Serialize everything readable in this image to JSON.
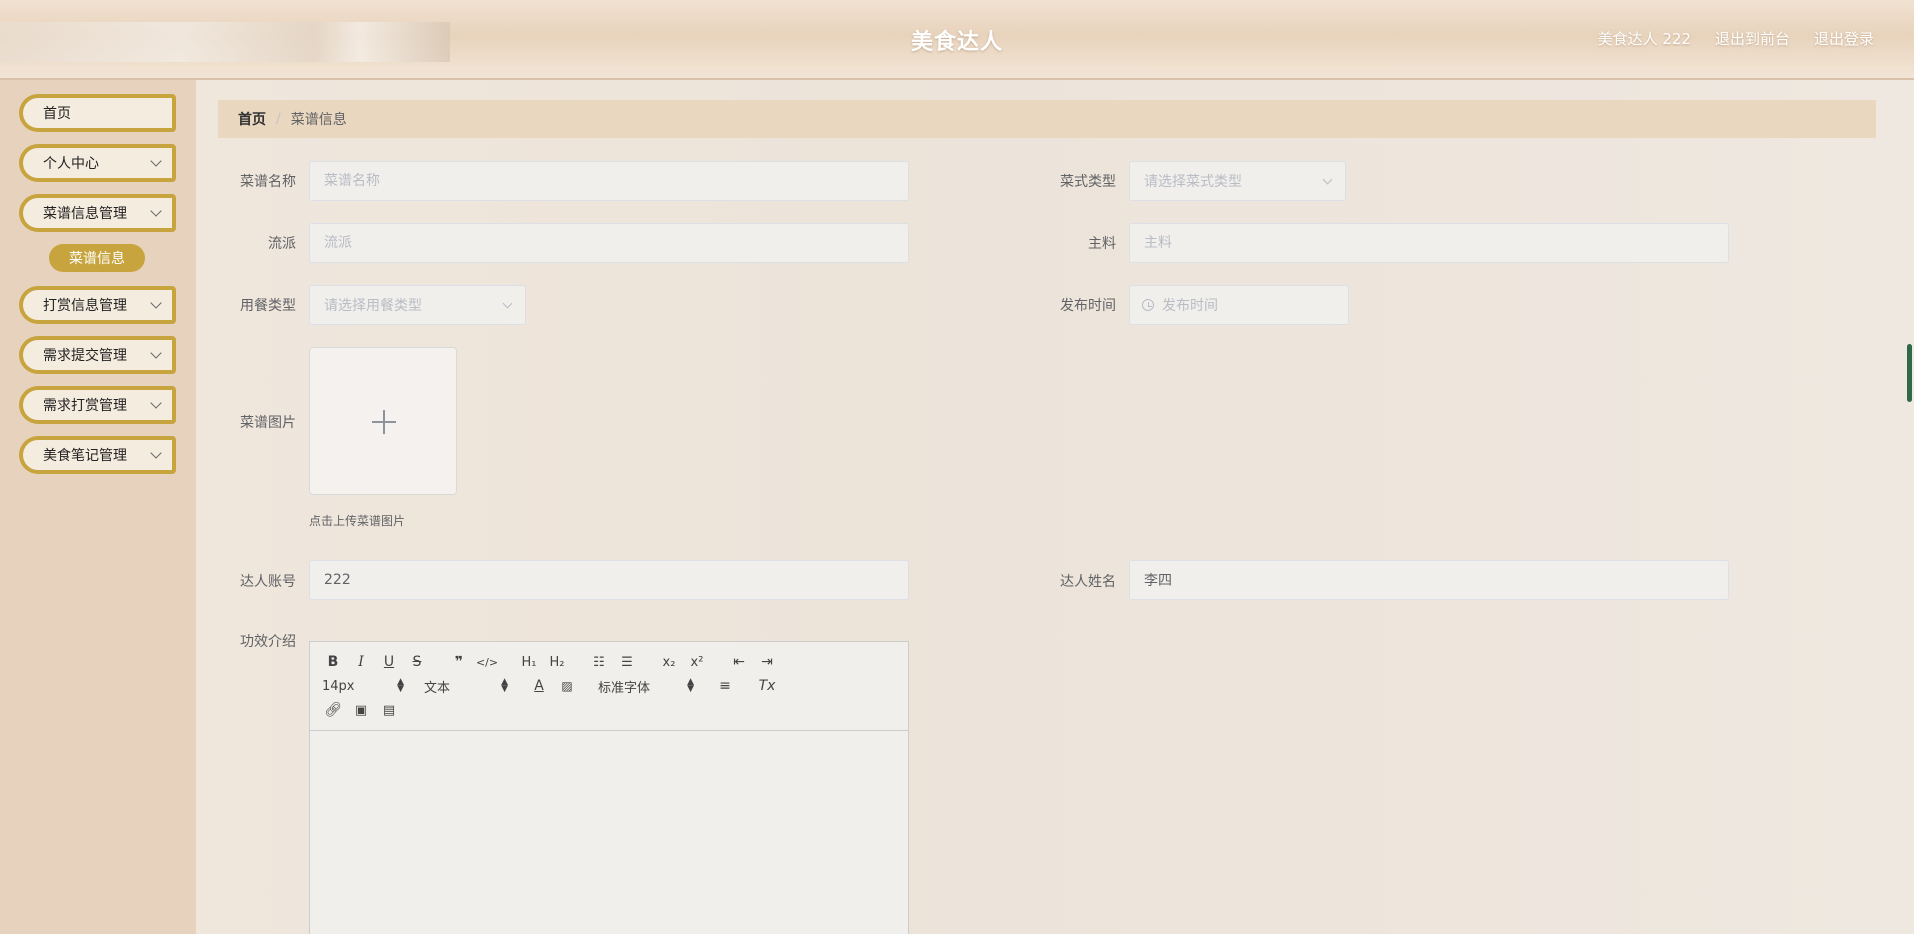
{
  "header": {
    "title": "美食达人",
    "user_label": "美食达人 222",
    "to_front_label": "退出到前台",
    "logout_label": "退出登录"
  },
  "sidebar": {
    "items": [
      {
        "label": "首页",
        "has_chevron": false
      },
      {
        "label": "个人中心",
        "has_chevron": true
      },
      {
        "label": "菜谱信息管理",
        "has_chevron": true
      },
      {
        "label": "打赏信息管理",
        "has_chevron": true
      },
      {
        "label": "需求提交管理",
        "has_chevron": true
      },
      {
        "label": "需求打赏管理",
        "has_chevron": true
      },
      {
        "label": "美食笔记管理",
        "has_chevron": true
      }
    ],
    "active_sub_item": "菜谱信息"
  },
  "breadcrumb": {
    "home": "首页",
    "separator": "/",
    "current": "菜谱信息"
  },
  "form": {
    "recipe_name": {
      "label": "菜谱名称",
      "placeholder": "菜谱名称",
      "value": ""
    },
    "dish_type": {
      "label": "菜式类型",
      "placeholder": "请选择菜式类型"
    },
    "school": {
      "label": "流派",
      "placeholder": "流派",
      "value": ""
    },
    "main_ingredient": {
      "label": "主料",
      "placeholder": "主料",
      "value": ""
    },
    "meal_type": {
      "label": "用餐类型",
      "placeholder": "请选择用餐类型"
    },
    "publish_time": {
      "label": "发布时间",
      "placeholder": "发布时间"
    },
    "recipe_image": {
      "label": "菜谱图片",
      "tip": "点击上传菜谱图片"
    },
    "expert_account": {
      "label": "达人账号",
      "value": "222"
    },
    "expert_name": {
      "label": "达人姓名",
      "value": "李四"
    },
    "efficacy": {
      "label": "功效介绍"
    }
  },
  "editor": {
    "font_size": "14px",
    "heading": "文本",
    "font_family": "标准字体"
  },
  "colors": {
    "accent": "#c7a43e",
    "sidebar_bg": "#e7d3bd",
    "breadcrumb_bg": "#ead7bf"
  }
}
